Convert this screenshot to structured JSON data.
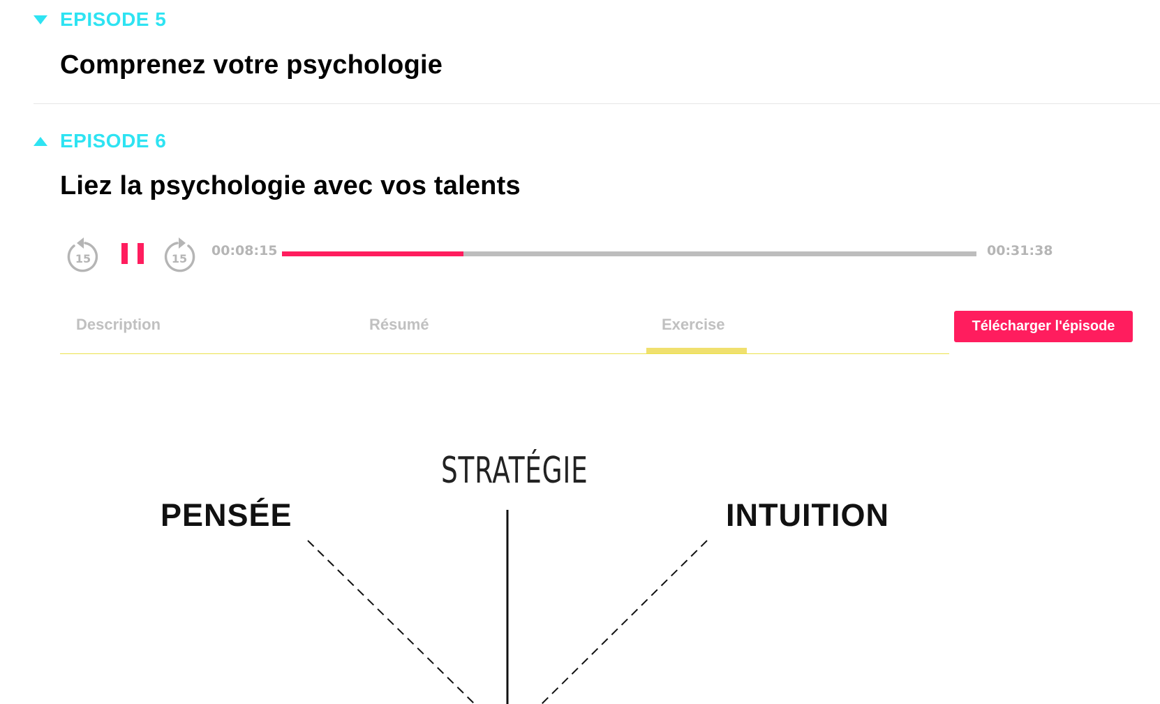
{
  "episodes": [
    {
      "label": "EPISODE 5",
      "title": "Comprenez votre psychologie",
      "expanded": false
    },
    {
      "label": "EPISODE 6",
      "title": "Liez la psychologie avec vos talents",
      "expanded": true
    }
  ],
  "player": {
    "rewind_icon": "rewind-15-icon",
    "rewind_seconds": "15",
    "forward_icon": "forward-15-icon",
    "forward_seconds": "15",
    "state": "playing",
    "pause_icon": "pause-icon",
    "current_time": "00:08:15",
    "total_time": "00:31:38",
    "progress": 0.261
  },
  "tabs": {
    "items": [
      "Description",
      "Résumé",
      "Exercise"
    ],
    "active": "Exercise"
  },
  "download_label": "Télécharger l'épisode",
  "diagram": {
    "top_label": "STRATÉGIE",
    "left_label": "PENSÉE",
    "right_label": "INTUITION"
  },
  "colors": {
    "accent_cyan": "#2ee3f2",
    "accent_pink": "#ff1d5e",
    "tab_underline": "#f0e06e",
    "muted_grey": "#b5b5b5"
  }
}
